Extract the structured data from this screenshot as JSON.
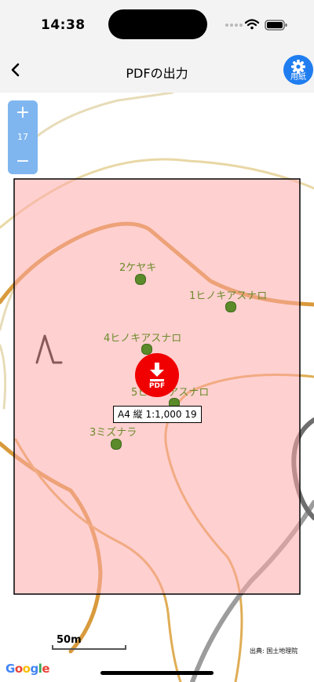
{
  "status": {
    "time": "14:38"
  },
  "nav": {
    "title": "PDFの出力",
    "back_icon": "chevron-left-icon",
    "paper_label": "用紙",
    "paper_icon": "gear-icon"
  },
  "zoom": {
    "in_label": "+",
    "level": "17",
    "out_label": "−"
  },
  "trees": [
    {
      "label": "2ケヤキ"
    },
    {
      "label": "1ヒノキアスナロ"
    },
    {
      "label": "4ヒノキアスナロ"
    },
    {
      "label": "5ヒノキアスナロ"
    },
    {
      "label": "3ミズナラ"
    }
  ],
  "pdf_button": {
    "label": "PDF",
    "icon": "download-icon"
  },
  "scale_info": "A4 縦 1:1,000 19",
  "scale_bar": {
    "label": "50m"
  },
  "attribution": "出典: 国土地理院",
  "google_logo": "Google",
  "colors": {
    "accent": "#1f7df0",
    "pdf": "#f00000",
    "print_area": "#ffcccc",
    "tree": "#5b8a2a"
  }
}
